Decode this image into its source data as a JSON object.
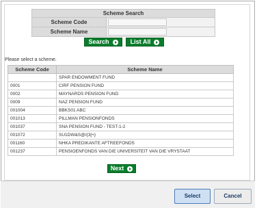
{
  "search": {
    "title": "Scheme Search",
    "code_label": "Scheme Code",
    "name_label": "Scheme Name",
    "code_value": "",
    "name_value": "",
    "search_button": "Search",
    "listall_button": "List All"
  },
  "prompt": "Please select a scheme.",
  "table": {
    "headers": [
      "Scheme Code",
      "Scheme Name"
    ],
    "rows": [
      [
        "",
        "SPAR ENDOWMENT FUND"
      ],
      [
        "0001",
        "CIRF PENSION FUND"
      ],
      [
        "0002",
        "MAYNARDS PENSION FUND"
      ],
      [
        "0009",
        "NAZ PENSION FUND"
      ],
      [
        "001004",
        "BBKS01 ABC"
      ],
      [
        "001013",
        "PILLMAN PENSIONFONDS"
      ],
      [
        "001037",
        "SNA PENSION FUND - TEST-1-2"
      ],
      [
        "001072",
        "SU1DW&S@/{3[+}"
      ],
      [
        "001160",
        "NHKA PREDIKANTE AFTREEFONDS"
      ],
      [
        "001237",
        "PENSIOENFONDS VAN DIE UNIVERSITEIT VAN DIE VRYSTAAT"
      ]
    ]
  },
  "pager": {
    "next_button": "Next"
  },
  "dialog": {
    "select_button": "Select",
    "cancel_button": "Cancel"
  },
  "colors": {
    "accent_green": "#0a7d2c",
    "header_grey": "#dcdcdc",
    "select_blue": "#cfe0f5"
  }
}
